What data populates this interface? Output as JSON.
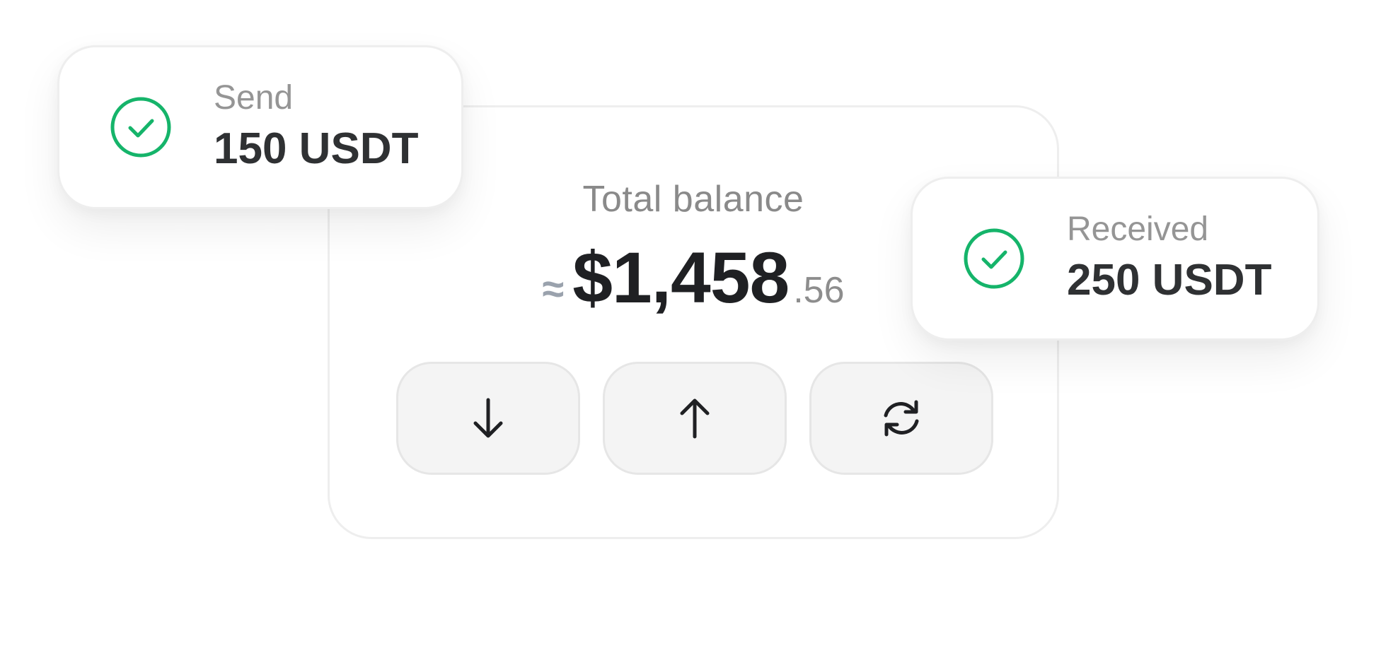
{
  "balance": {
    "title": "Total balance",
    "approx_symbol": "≈",
    "amount_whole": "$1,458",
    "amount_cents": ".56"
  },
  "actions": [
    {
      "icon": "arrow-down-icon"
    },
    {
      "icon": "arrow-up-icon"
    },
    {
      "icon": "swap-refresh-icon"
    }
  ],
  "notifications": {
    "send": {
      "label": "Send",
      "value": "150 USDT",
      "icon": "check-circle-icon"
    },
    "received": {
      "label": "Received",
      "value": "250 USDT",
      "icon": "check-circle-icon"
    }
  },
  "colors": {
    "success": "#15b46a",
    "text_primary": "#1f2023",
    "text_muted": "#8a8a8a",
    "button_bg": "#f4f4f4",
    "border": "#eeeeee"
  }
}
